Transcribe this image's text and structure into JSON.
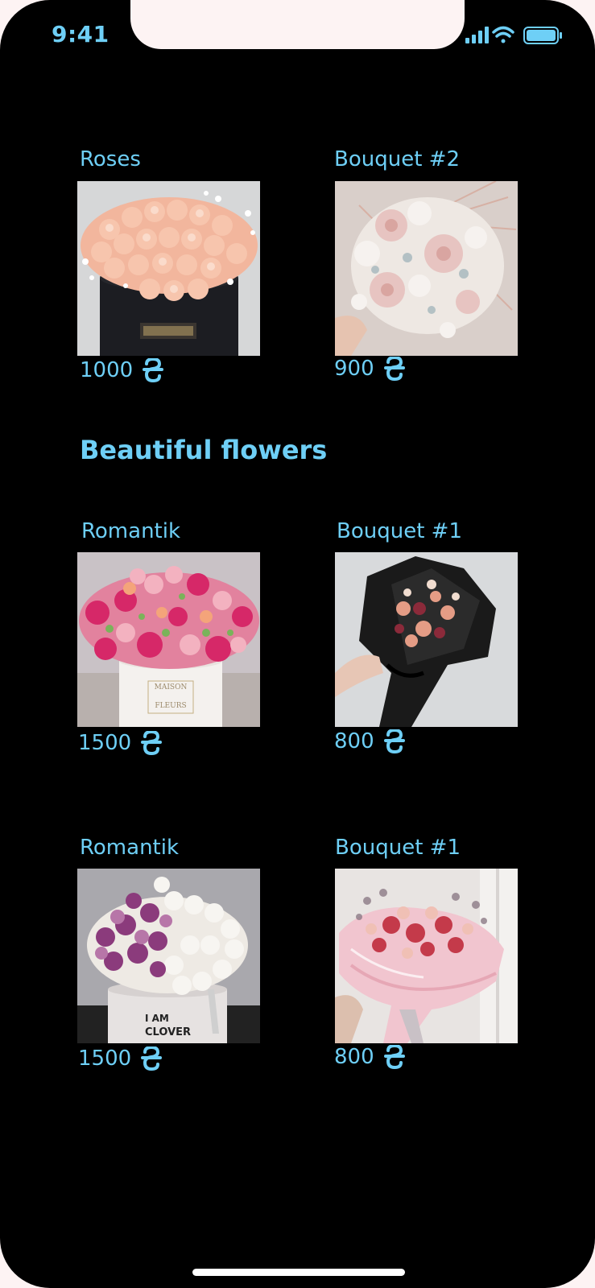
{
  "status": {
    "time": "9:41"
  },
  "section": {
    "title": "Beautiful flowers"
  },
  "currency_icon": "ruble-sign-icon",
  "products": [
    {
      "name": "Roses",
      "price": "1000"
    },
    {
      "name": "Bouquet #2",
      "price": "900"
    },
    {
      "name": "Romantik",
      "price": "1500"
    },
    {
      "name": "Bouquet #1",
      "price": "800"
    },
    {
      "name": "Romantik",
      "price": "1500"
    },
    {
      "name": "Bouquet #1",
      "price": "800"
    }
  ],
  "colors": {
    "accent": "#6ecff6",
    "background": "#000000",
    "frame": "#fdf3f3"
  }
}
